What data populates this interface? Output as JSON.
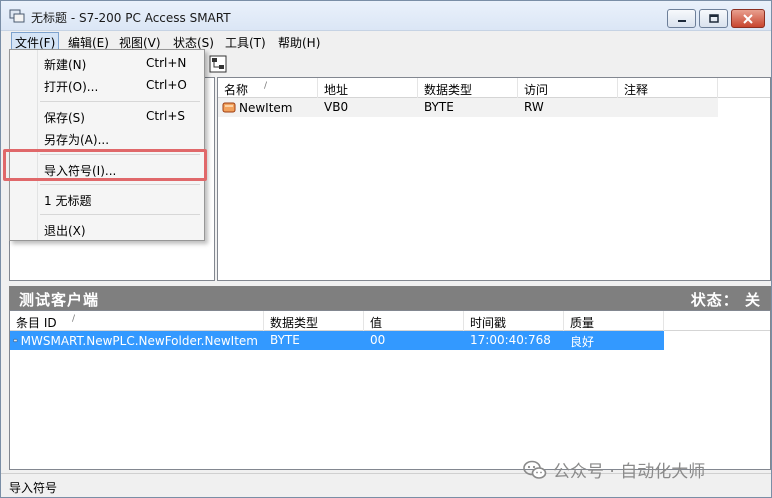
{
  "window": {
    "title": "无标题 - S7-200 PC Access SMART"
  },
  "menubar": {
    "items": [
      {
        "label": "文件(F)"
      },
      {
        "label": "编辑(E)"
      },
      {
        "label": "视图(V)"
      },
      {
        "label": "状态(S)"
      },
      {
        "label": "工具(T)"
      },
      {
        "label": "帮助(H)"
      }
    ]
  },
  "file_menu": {
    "items": [
      {
        "label": "新建(N)",
        "shortcut": "Ctrl+N"
      },
      {
        "label": "打开(O)...",
        "shortcut": "Ctrl+O"
      },
      {
        "label": "保存(S)",
        "shortcut": "Ctrl+S"
      },
      {
        "label": "另存为(A)...",
        "shortcut": ""
      },
      {
        "label": "导入符号(I)...",
        "shortcut": ""
      },
      {
        "label": "1 无标题",
        "shortcut": ""
      },
      {
        "label": "退出(X)",
        "shortcut": ""
      }
    ]
  },
  "item_list": {
    "columns": [
      "名称",
      "地址",
      "数据类型",
      "访问",
      "注释"
    ],
    "rows": [
      {
        "name": "NewItem",
        "address": "VB0",
        "type": "BYTE",
        "access": "RW",
        "comment": ""
      }
    ]
  },
  "client": {
    "title": "测试客户端",
    "status": "状态： 关",
    "columns": [
      "条目 ID",
      "数据类型",
      "值",
      "时间戳",
      "质量"
    ],
    "rows": [
      {
        "id": "MWSMART.NewPLC.NewFolder.NewItem",
        "type": "BYTE",
        "value": "00",
        "timestamp": "17:00:40:768",
        "quality": "良好"
      }
    ]
  },
  "statusbar": {
    "text": "导入符号"
  },
  "watermark": {
    "text": "公众号 · 自动化大师"
  },
  "colors": {
    "selection": "#3399ff",
    "highlight_box": "#e0686a",
    "client_bar": "#7f7f7f"
  }
}
